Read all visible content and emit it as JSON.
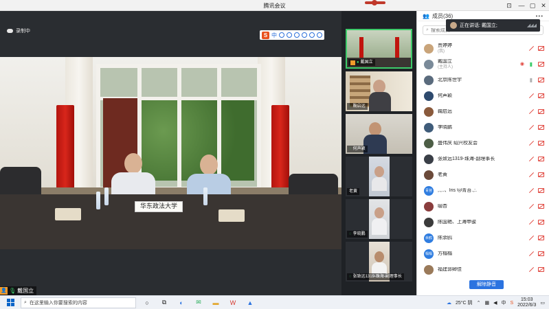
{
  "window": {
    "title": "腾讯会议",
    "minimize": "—",
    "restore": "▢",
    "close": "✕",
    "pin": "⊡"
  },
  "recording": {
    "label": "录制中"
  },
  "ime_toolbar": {
    "logo": "S",
    "lang": "中"
  },
  "main_video": {
    "nameplate": "华东政法大学",
    "speaker_name": "戴国立"
  },
  "gallery": [
    {
      "name": "戴国立",
      "active": true
    },
    {
      "name": "鞠启远"
    },
    {
      "name": "何声颖"
    },
    {
      "name": "老黄"
    },
    {
      "name": "李晓鹏"
    },
    {
      "name": "张致远1319-珠海-副理事长"
    }
  ],
  "panel": {
    "title": "成员(36)",
    "more": "•••",
    "speaking_label": "正在讲话: 戴国立;",
    "search_placeholder": "搜索成员",
    "unmute_all": "解除静音"
  },
  "members": [
    {
      "name": "贾婷婷",
      "sub": "(我)",
      "avatar_color": "#c9a47a",
      "avatar_text": "",
      "mic": "off",
      "eye": false
    },
    {
      "name": "戴国立",
      "sub": "(主持人)",
      "avatar_color": "#7a8a99",
      "avatar_text": "",
      "mic": "on",
      "eye": true
    },
    {
      "name": "北京陈世宇",
      "sub": "",
      "avatar_color": "#5a6b7d",
      "avatar_text": "",
      "mic": "gray",
      "eye": false
    },
    {
      "name": "何声颖",
      "sub": "",
      "avatar_color": "#2e4a6e",
      "avatar_text": "",
      "mic": "off",
      "eye": false
    },
    {
      "name": "鞠启远",
      "sub": "",
      "avatar_color": "#8a5a3c",
      "avatar_text": "",
      "mic": "off",
      "eye": false
    },
    {
      "name": "李晓鹏",
      "sub": "",
      "avatar_color": "#3f5c7a",
      "avatar_text": "",
      "mic": "off",
      "eye": false
    },
    {
      "name": "盛伟庆 绍兴校友会",
      "sub": "",
      "avatar_color": "#4d5e46",
      "avatar_text": "",
      "mic": "off",
      "eye": false
    },
    {
      "name": "张致远1319-珠海-副理事长",
      "sub": "",
      "avatar_color": "#3a3f47",
      "avatar_text": "",
      "mic": "off",
      "eye": false
    },
    {
      "name": "老黄",
      "sub": "",
      "avatar_color": "#6b4a3a",
      "avatar_text": "",
      "mic": "off",
      "eye": false
    },
    {
      "name": ",.,..、Iris 🐱青苔.,:.",
      "sub": "",
      "avatar_color": "#2f7de0",
      "avatar_text": "青苔",
      "mic": "off",
      "eye": false
    },
    {
      "name": "喻杏",
      "sub": "",
      "avatar_color": "#8a3d3d",
      "avatar_text": "",
      "mic": "off",
      "eye": false
    },
    {
      "name": "陈国艳、上海申骏",
      "sub": "",
      "avatar_color": "#3b3b3b",
      "avatar_text": "",
      "mic": "off",
      "eye": false
    },
    {
      "name": "陈余鸥",
      "sub": "",
      "avatar_color": "#2f7de0",
      "avatar_text": "余鸥",
      "mic": "off",
      "eye": false
    },
    {
      "name": "方榻榻",
      "sub": "",
      "avatar_color": "#2f7de0",
      "avatar_text": "榻榻",
      "mic": "off",
      "eye": false
    },
    {
      "name": "福建郭卿佳",
      "sub": "",
      "avatar_color": "#9a7a5a",
      "avatar_text": "",
      "mic": "off",
      "eye": false
    }
  ],
  "taskbar": {
    "search_placeholder": "在这里输入你要搜索的内容",
    "weather": "25°C 阴",
    "ime": "中",
    "time": "15:03",
    "date": "2022/6/3"
  }
}
